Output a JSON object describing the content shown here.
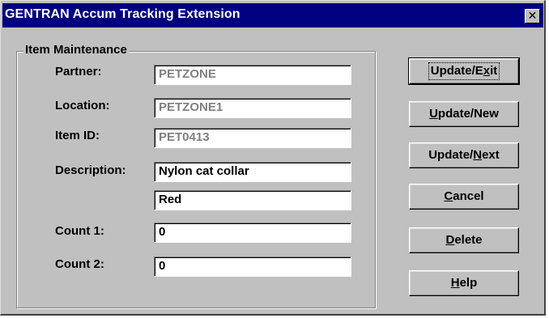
{
  "window": {
    "title": "GENTRAN Accum Tracking Extension",
    "close_glyph": "✕"
  },
  "group": {
    "title": "Item Maintenance"
  },
  "fields": {
    "partner": {
      "label": "Partner:",
      "value": "PETZONE"
    },
    "location": {
      "label": "Location:",
      "value": "PETZONE1"
    },
    "item_id": {
      "label": "Item ID:",
      "value": "PET0413"
    },
    "description": {
      "label": "Description:",
      "value": "Nylon cat collar",
      "value2": "Red"
    },
    "count1": {
      "label": "Count 1:",
      "value": "0"
    },
    "count2": {
      "label": "Count 2:",
      "value": "0"
    }
  },
  "buttons": {
    "update_exit": {
      "pre": "Update/E",
      "accel": "x",
      "post": "it"
    },
    "update_new": {
      "pre": "",
      "accel": "U",
      "post": "pdate/New"
    },
    "update_next": {
      "pre": "Update/",
      "accel": "N",
      "post": "ext"
    },
    "cancel": {
      "pre": "",
      "accel": "C",
      "post": "ancel"
    },
    "delete": {
      "pre": "",
      "accel": "D",
      "post": "elete"
    },
    "help": {
      "pre": "",
      "accel": "H",
      "post": "elp"
    }
  },
  "colors": {
    "titlebar": "#000080",
    "face": "#c0c0c0",
    "disabled_text": "#808080"
  }
}
